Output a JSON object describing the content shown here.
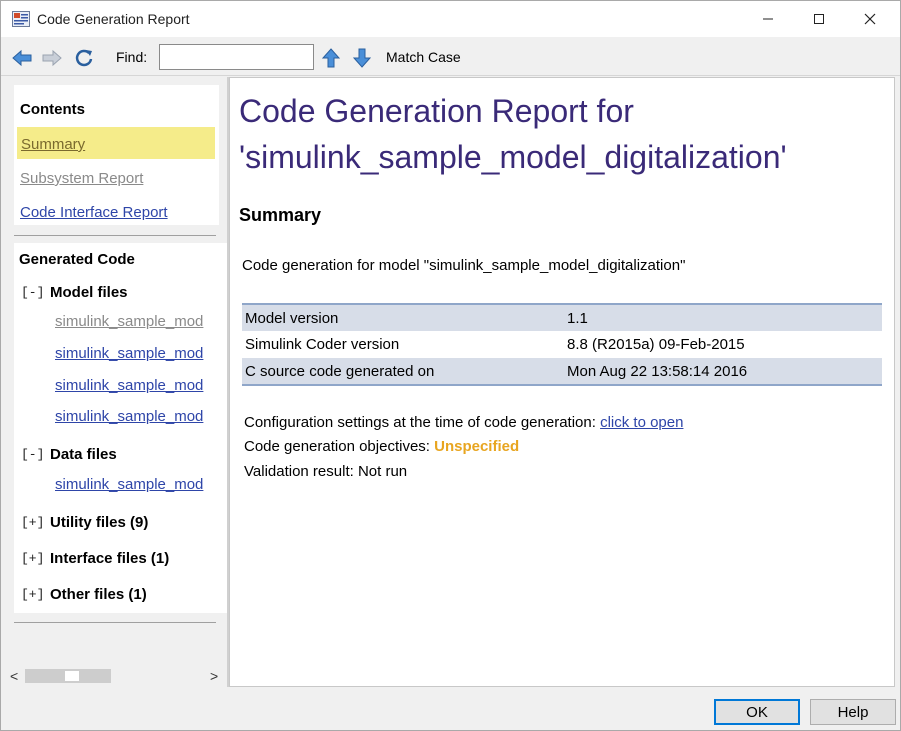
{
  "window": {
    "title": "Code Generation Report"
  },
  "toolbar": {
    "find_label": "Find:",
    "find_value": "",
    "match_case_label": "Match Case"
  },
  "contents": {
    "title": "Contents",
    "items": [
      {
        "label": "Summary"
      },
      {
        "label": "Subsystem Report"
      },
      {
        "label": "Code Interface Report"
      }
    ]
  },
  "generated_code": {
    "title": "Generated Code",
    "model_files": {
      "toggle": "[-]",
      "label": "Model files",
      "files": [
        "simulink_sample_mod",
        "simulink_sample_mod",
        "simulink_sample_mod",
        "simulink_sample_mod"
      ]
    },
    "data_files": {
      "toggle": "[-]",
      "label": "Data files",
      "files": [
        "simulink_sample_mod"
      ]
    },
    "utility_files": {
      "toggle": "[+]",
      "label": "Utility files (9)"
    },
    "interface_files": {
      "toggle": "[+]",
      "label": "Interface files (1)"
    },
    "other_files": {
      "toggle": "[+]",
      "label": "Other files (1)"
    }
  },
  "scrollbar": {
    "left_arrow": "<",
    "right_arrow": ">"
  },
  "report": {
    "title_line1": "Code Generation Report for",
    "title_line2": "'simulink_sample_model_digitalization'",
    "summary_heading": "Summary",
    "gen_for_text": "Code generation for model \"simulink_sample_model_digitalization\"",
    "table": [
      {
        "key": "Model version",
        "value": "1.1"
      },
      {
        "key": "Simulink Coder version",
        "value": "8.8 (R2015a) 09-Feb-2015"
      },
      {
        "key": "C source code generated on",
        "value": "Mon Aug 22 13:58:14 2016"
      }
    ],
    "config_label": "Configuration settings at the time of code generation: ",
    "config_link": "click to open",
    "objectives_label": "Code generation objectives: ",
    "objectives_value": "Unspecified",
    "validation_text": "Validation result: Not run"
  },
  "buttons": {
    "ok": "OK",
    "help": "Help"
  },
  "colors": {
    "title_purple": "#3a2a78",
    "link_blue": "#2e45a8",
    "highlight_yellow": "#f5ec8a",
    "unspecified_orange": "#e8a520",
    "table_shade": "#d7dde8"
  }
}
